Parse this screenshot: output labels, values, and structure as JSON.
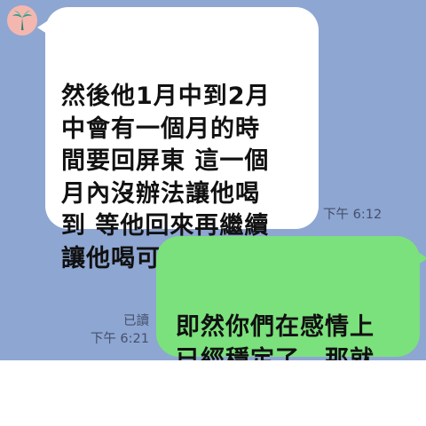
{
  "conversation": {
    "contact_avatar_icon": "palm-tree-icon",
    "colors": {
      "chat_background": "#8ea6d2",
      "incoming_bubble": "#ffffff",
      "outgoing_bubble": "#7be17c",
      "avatar_background": "#f4b7b0",
      "timestamp_text": "#44506a"
    },
    "messages": [
      {
        "direction": "incoming",
        "text": "然後他1月中到2月\n中會有一個月的時\n間要回屏東 這一個\n月內沒辦法讓他喝\n到 等他回來再繼續\n讓他喝可以嗎？",
        "time": "下午 6:12"
      },
      {
        "direction": "outgoing",
        "text": "即然你們在感情上\n已經穩定了，那就\n不用在喝了",
        "read_status": "已讀",
        "time": "下午 6:21"
      }
    ]
  }
}
